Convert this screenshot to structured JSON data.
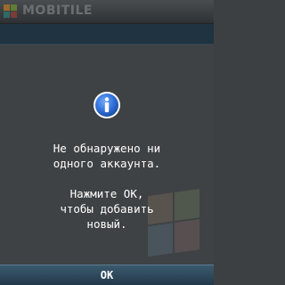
{
  "app": {
    "title": "MOBITILE",
    "logo_icon": "tiles-logo-icon"
  },
  "dialog": {
    "icon": "info-icon",
    "line1": "Не обнаружено ни",
    "line2": "одного аккаунта.",
    "line3": "Нажмите OK,",
    "line4": "чтобы добавить",
    "line5": "новый."
  },
  "softkeys": {
    "center_label": "OK"
  },
  "colors": {
    "background": "#3d4042",
    "header_strip": "#1f3340",
    "softkey_bar": "#2d4759",
    "info_icon": "#2f6fd6",
    "text": "#ffffff"
  }
}
